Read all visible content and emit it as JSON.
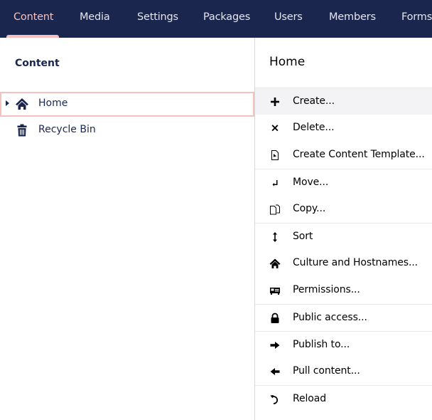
{
  "nav": {
    "items": [
      {
        "label": "Content",
        "active": true
      },
      {
        "label": "Media",
        "active": false
      },
      {
        "label": "Settings",
        "active": false
      },
      {
        "label": "Packages",
        "active": false
      },
      {
        "label": "Users",
        "active": false
      },
      {
        "label": "Members",
        "active": false
      },
      {
        "label": "Forms",
        "active": false
      }
    ],
    "accent_color": "#f5c1bc",
    "background_color": "#1b264f"
  },
  "tree": {
    "title": "Content",
    "nodes": [
      {
        "label": "Home",
        "icon": "home-icon",
        "has_children": true,
        "selected": true
      },
      {
        "label": "Recycle Bin",
        "icon": "trash-icon",
        "has_children": false,
        "selected": false
      }
    ]
  },
  "actions": {
    "title": "Home",
    "items": [
      {
        "label": "Create...",
        "icon": "plus-icon"
      },
      {
        "label": "Delete...",
        "icon": "x-icon"
      },
      {
        "label": "Create Content Template...",
        "icon": "document-template-icon"
      },
      {
        "label": "Move...",
        "icon": "move-icon"
      },
      {
        "label": "Copy...",
        "icon": "copy-icon"
      },
      {
        "label": "Sort",
        "icon": "sort-icon"
      },
      {
        "label": "Culture and Hostnames...",
        "icon": "home-icon"
      },
      {
        "label": "Permissions...",
        "icon": "permissions-icon"
      },
      {
        "label": "Public access...",
        "icon": "lock-icon"
      },
      {
        "label": "Publish to...",
        "icon": "arrow-right-icon"
      },
      {
        "label": "Pull content...",
        "icon": "arrow-left-icon"
      },
      {
        "label": "Reload",
        "icon": "reload-icon"
      }
    ]
  }
}
